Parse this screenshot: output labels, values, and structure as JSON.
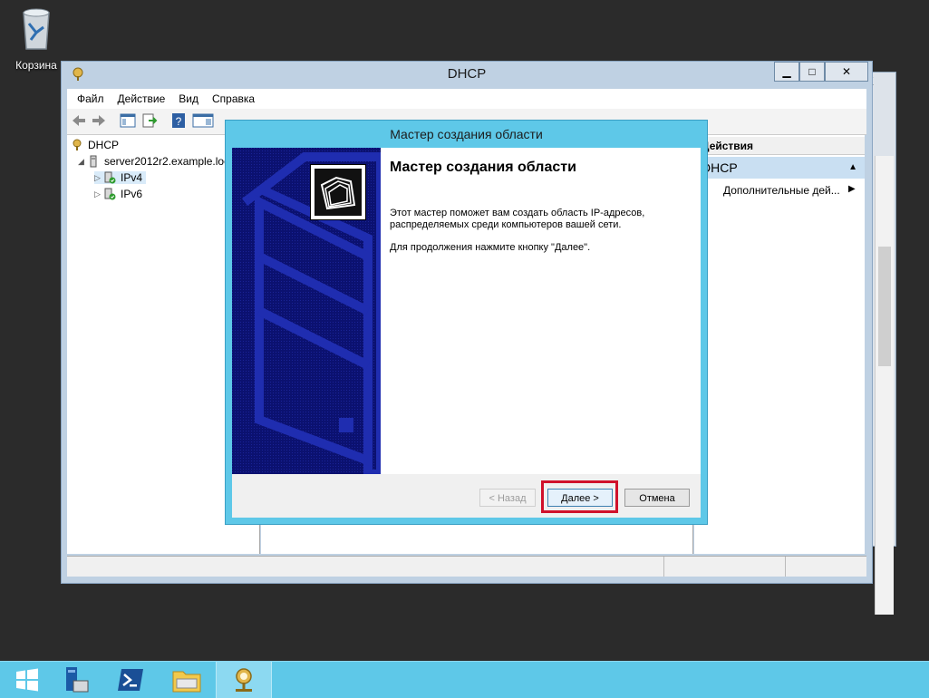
{
  "desktop": {
    "recycle_bin_label": "Корзина",
    "recycle_bin_icon": "recycle-bin-icon"
  },
  "background_window": {
    "close_glyph": "X"
  },
  "mmc": {
    "title": "DHCP",
    "window_buttons": {
      "minimize": "▁",
      "maximize": "□",
      "close": "✕"
    },
    "menu": [
      "Файл",
      "Действие",
      "Вид",
      "Справка"
    ],
    "toolbar_icons": [
      "back-arrow-icon",
      "forward-arrow-icon",
      "show-hide-console-tree-icon",
      "export-list-icon",
      "help-icon",
      "show-hide-action-pane-icon"
    ],
    "tree": [
      {
        "label": "DHCP",
        "icon": "dhcp-icon",
        "expander": ""
      },
      {
        "label": "server2012r2.example.loc",
        "icon": "server-icon",
        "expander": "◢"
      },
      {
        "label": "IPv4",
        "icon": "ipv4-icon",
        "expander": "▷"
      },
      {
        "label": "IPv6",
        "icon": "ipv6-icon",
        "expander": "▷"
      }
    ],
    "actions": {
      "header": "Действия",
      "section": "DHCP",
      "section_toggle": "▲",
      "more": "Дополнительные дей...",
      "more_arrow": "▶"
    }
  },
  "wizard": {
    "title": "Мастер создания области",
    "heading": "Мастер создания области",
    "paragraph1": "Этот мастер поможет вам создать область IP-адресов, распределяемых среди компьютеров вашей сети.",
    "paragraph2": "Для продолжения нажмите кнопку \"Далее\".",
    "buttons": {
      "back": "< Назад",
      "next": "Далее >",
      "cancel": "Отмена"
    },
    "highlight_color": "#d0112b",
    "banner_color": "#0b1170"
  },
  "taskbar": {
    "items": [
      "start-icon",
      "server-manager-icon",
      "powershell-icon",
      "file-explorer-icon",
      "dhcp-console-icon"
    ],
    "color": "#5ec8e8"
  }
}
